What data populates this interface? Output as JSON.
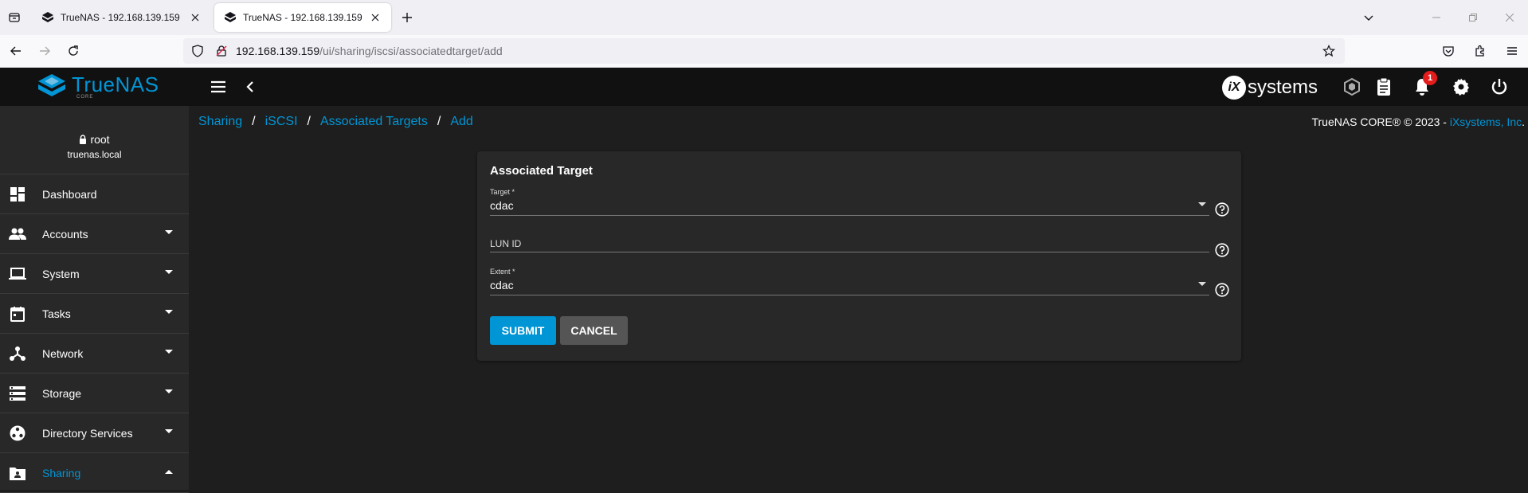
{
  "browser": {
    "tabs": [
      {
        "title": "TrueNAS - 192.168.139.159",
        "active": false
      },
      {
        "title": "TrueNAS - 192.168.139.159",
        "active": true
      }
    ],
    "url_host": "192.168.139.159",
    "url_path": "/ui/sharing/iscsi/associatedtarget/add"
  },
  "header": {
    "logo_text": "TrueNAS",
    "logo_sub": "CORE",
    "vendor_logo": "systems",
    "notification_count": "1"
  },
  "breadcrumb": [
    "Sharing",
    "iSCSI",
    "Associated Targets",
    "Add"
  ],
  "copyright": {
    "text": "TrueNAS CORE® © 2023 - ",
    "link": "iXsystems, Inc",
    "suffix": "."
  },
  "user": {
    "name": "root",
    "host": "truenas.local"
  },
  "sidebar": {
    "items": [
      {
        "label": "Dashboard",
        "icon": "dashboard-icon"
      },
      {
        "label": "Accounts",
        "icon": "accounts-icon"
      },
      {
        "label": "System",
        "icon": "laptop-icon"
      },
      {
        "label": "Tasks",
        "icon": "calendar-icon"
      },
      {
        "label": "Network",
        "icon": "network-icon"
      },
      {
        "label": "Storage",
        "icon": "storage-icon"
      },
      {
        "label": "Directory Services",
        "icon": "directory-icon"
      },
      {
        "label": "Sharing",
        "icon": "sharing-icon",
        "active": true
      }
    ]
  },
  "form": {
    "title": "Associated Target",
    "target_label": "Target *",
    "target_value": "cdac",
    "lun_label": "LUN ID",
    "extent_label": "Extent *",
    "extent_value": "cdac",
    "submit_label": "SUBMIT",
    "cancel_label": "CANCEL"
  },
  "colors": {
    "accent": "#0095d5",
    "header_bg": "#111111",
    "sidebar_bg": "#282828",
    "content_bg": "#1e1e1e",
    "card_bg": "#282828",
    "cancel_bg": "#555555",
    "badge": "#e31c1c"
  }
}
